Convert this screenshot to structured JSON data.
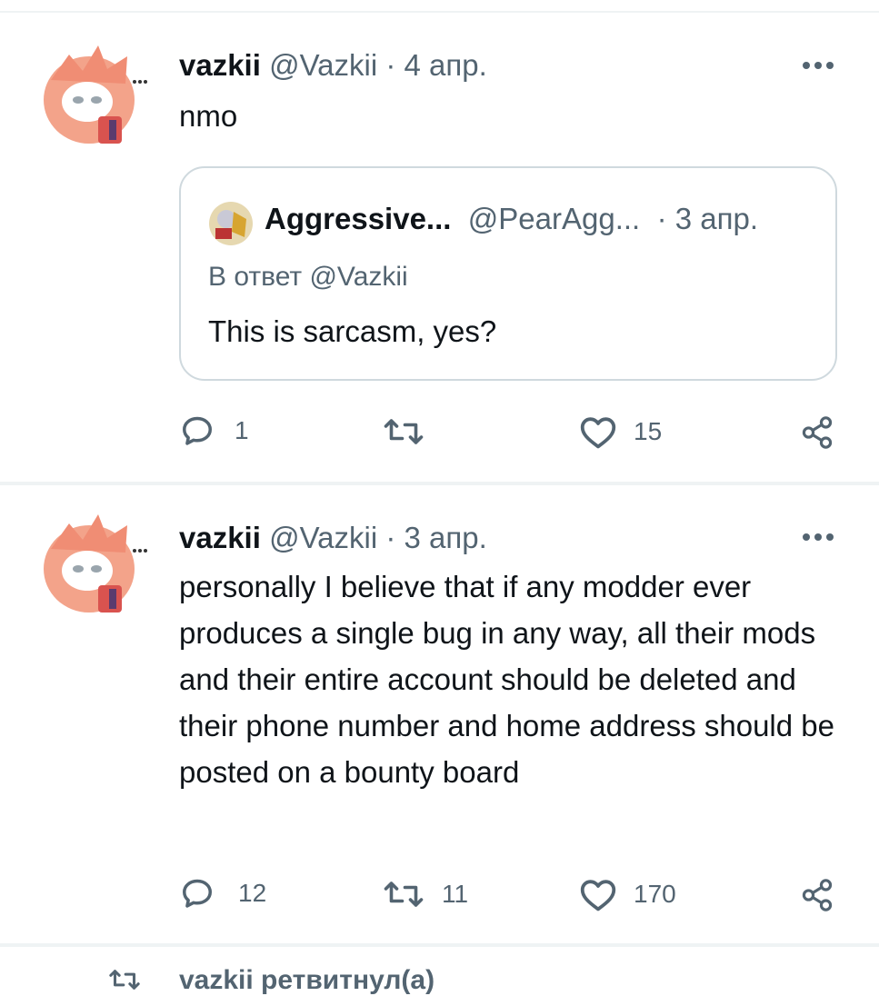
{
  "tweets": [
    {
      "author_name": "vazkii",
      "author_handle": "@Vazkii",
      "separator": "·",
      "date": "4 апр.",
      "text": "nmo",
      "quote": {
        "author_name": "Aggressive...",
        "author_handle": "@PearAgg...",
        "separator": "·",
        "date": "3 апр.",
        "reply_to": "В ответ @Vazkii",
        "text": "This is sarcasm, yes?"
      },
      "replies": "1",
      "retweets": "",
      "likes": "15"
    },
    {
      "author_name": "vazkii",
      "author_handle": "@Vazkii",
      "separator": "·",
      "date": "3 апр.",
      "text": "personally I believe that if any modder ever produces a single bug in any way, all their mods and their entire account should be deleted and their phone number and home address should be posted on a bounty board",
      "replies": "12",
      "retweets": "11",
      "likes": "170"
    }
  ],
  "retweet_banner": "vazkii ретвитнул(а)",
  "icons": {
    "reply": "reply-icon",
    "retweet": "retweet-icon",
    "like": "heart-icon",
    "share": "share-icon",
    "more": "more-icon"
  },
  "colors": {
    "text": "#0f1419",
    "muted": "#536471",
    "border": "#cfd9de",
    "divider": "#eff3f4"
  }
}
